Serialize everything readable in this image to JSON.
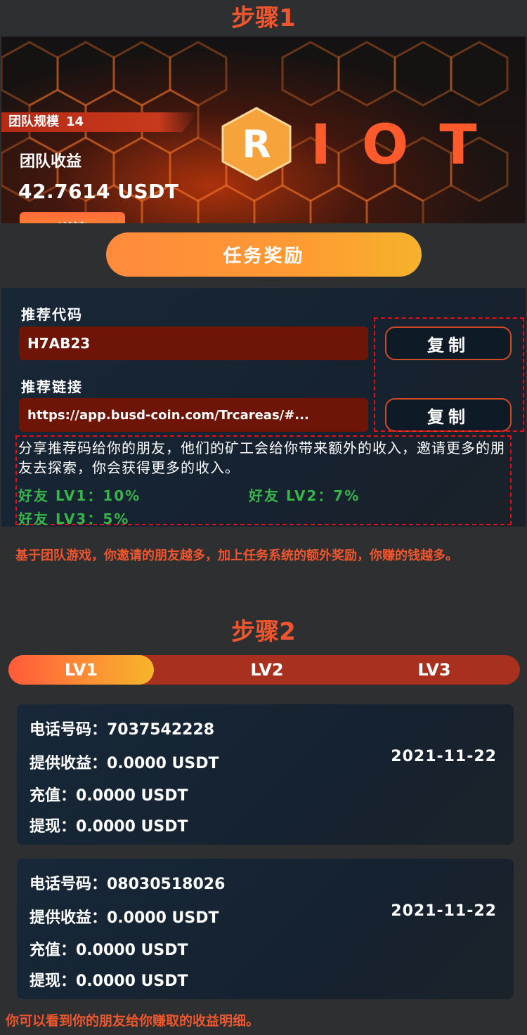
{
  "step1": {
    "title": "步骤1"
  },
  "banner": {
    "team_size_label": "团队规模",
    "team_size_value": "14",
    "team_earnings_label": "团队收益",
    "team_earnings_value": "42.7614 USDT",
    "detail_button": "详情",
    "logo_mark": "R",
    "logo_text": "IOT"
  },
  "task_reward_button": "任务奖励",
  "referral": {
    "code_label": "推荐代码",
    "code_value": "H7AB23",
    "copy_label": "复制",
    "link_label": "推荐链接",
    "link_value": "https://app.busd-coin.com/Trcareas/#...",
    "share_text": "分享推荐码给你的朋友，他们的矿工会给你带来额外的收入，邀请更多的朋友去探索，你会获得更多的收入。",
    "rates": [
      {
        "label": "好友 LV1：10%"
      },
      {
        "label": "好友 LV2：7%"
      },
      {
        "label": "好友 LV3：5%"
      }
    ]
  },
  "note": "基于团队游戏，你邀请的朋友越多，加上任务系统的额外奖励，你赚的钱越多。",
  "step2": {
    "title": "步骤2"
  },
  "tabs": [
    {
      "label": "LV1",
      "active": true
    },
    {
      "label": "LV2",
      "active": false
    },
    {
      "label": "LV3",
      "active": false
    }
  ],
  "friends": [
    {
      "phone": "电话号码：7037542228",
      "earnings": "提供收益：0.0000 USDT",
      "recharge": "充值：0.0000 USDT",
      "withdraw": "提现：0.0000 USDT",
      "date": "2021-11-22"
    },
    {
      "phone": "电话号码：08030518026",
      "earnings": "提供收益：0.0000 USDT",
      "recharge": "充值：0.0000 USDT",
      "withdraw": "提现：0.0000 USDT",
      "date": "2021-11-22"
    }
  ],
  "bottom_note": "你可以看到你的朋友给你赚取的收益明细。",
  "colors": {
    "accent": "#f0562e",
    "panel": "#162230",
    "input_bg": "#6e1507",
    "green": "#37b44a",
    "dashed_red": "#e0101a"
  }
}
